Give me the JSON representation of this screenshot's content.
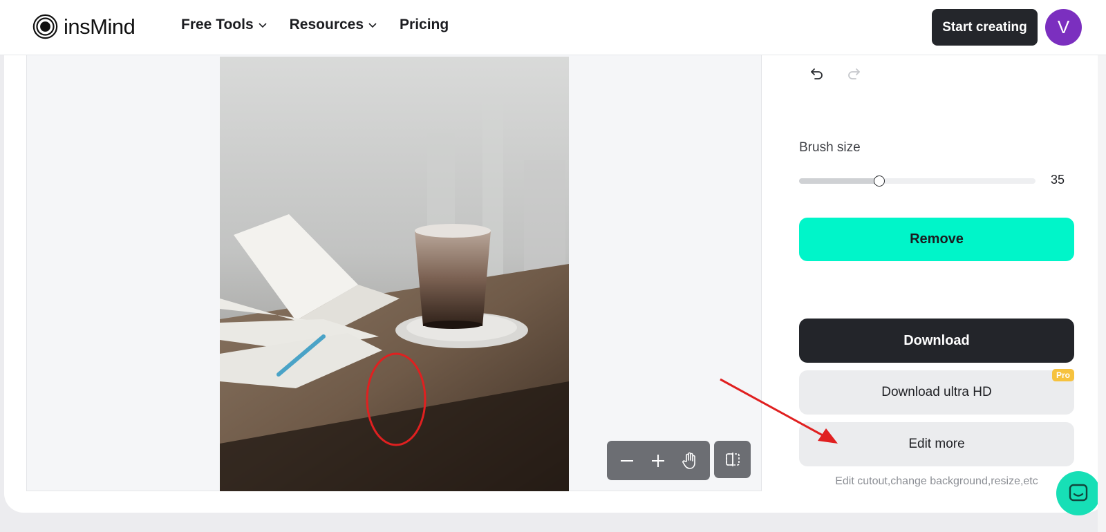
{
  "header": {
    "brand": "insMind",
    "nav": [
      {
        "label": "Free Tools",
        "has_dropdown": true
      },
      {
        "label": "Resources",
        "has_dropdown": true
      },
      {
        "label": "Pricing",
        "has_dropdown": false
      }
    ],
    "start_button": "Start creating",
    "avatar_initial": "V",
    "avatar_color": "#7b2fbf"
  },
  "canvas": {
    "tools": [
      "zoom-out-icon",
      "zoom-in-icon",
      "hand-pan-icon",
      "compare-icon"
    ]
  },
  "panel": {
    "brush_label": "Brush size",
    "brush_value": "35",
    "brush_fraction": 0.34,
    "remove_button": "Remove",
    "download_button": "Download",
    "download_hd_button": "Download ultra HD",
    "pro_badge": "Pro",
    "edit_more_button": "Edit more",
    "edit_hint": "Edit cutout,change background,resize,etc"
  },
  "colors": {
    "accent": "#00f5c9",
    "dark_button": "#23252a",
    "annotation_red": "#e02020"
  }
}
